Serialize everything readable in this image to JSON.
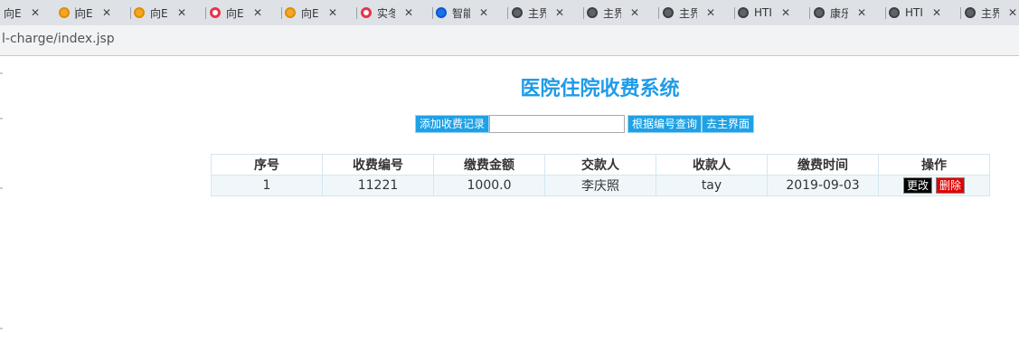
{
  "browser": {
    "tabs": [
      {
        "title": "向E",
        "favicon": "orange-circle-icon",
        "fav": "fav-orange"
      },
      {
        "title": "向E",
        "favicon": "orange-circle-icon",
        "fav": "fav-orange"
      },
      {
        "title": "向E",
        "favicon": "orange-circle-icon",
        "fav": "fav-orange"
      },
      {
        "title": "向E",
        "favicon": "red-ring-icon",
        "fav": "fav-red"
      },
      {
        "title": "向E",
        "favicon": "orange-circle-icon",
        "fav": "fav-orange"
      },
      {
        "title": "实冬",
        "favicon": "red-ring-icon",
        "fav": "fav-red"
      },
      {
        "title": "智能",
        "favicon": "blue-circle-icon",
        "fav": "fav-blue"
      },
      {
        "title": "主界",
        "favicon": "globe-icon",
        "fav": "fav-globe"
      },
      {
        "title": "主界",
        "favicon": "globe-icon",
        "fav": "fav-globe"
      },
      {
        "title": "主界",
        "favicon": "globe-icon",
        "fav": "fav-globe"
      },
      {
        "title": "HTI",
        "favicon": "globe-icon",
        "fav": "fav-globe"
      },
      {
        "title": "康乐",
        "favicon": "globe-icon",
        "fav": "fav-globe"
      },
      {
        "title": "HTI",
        "favicon": "globe-icon",
        "fav": "fav-globe"
      },
      {
        "title": "主界",
        "favicon": "globe-icon",
        "fav": "fav-globe"
      }
    ],
    "close_glyph": "✕",
    "url": "l-charge/index.jsp"
  },
  "page": {
    "title": "医院住院收费系统",
    "toolbar": {
      "add_label": "添加收费记录",
      "search_value": "",
      "search_label": "根据编号查询",
      "home_label": "去主界面"
    },
    "table": {
      "headers": [
        "序号",
        "收费编号",
        "缴费金额",
        "交款人",
        "收款人",
        "缴费时间",
        "操作"
      ],
      "rows": [
        {
          "seq": "1",
          "charge_no": "11221",
          "amount": "1000.0",
          "payer": "李庆照",
          "receiver": "tay",
          "date": "2019-09-03",
          "edit_label": "更改",
          "delete_label": "删除"
        }
      ]
    }
  },
  "colors": {
    "accent": "#1e9be8",
    "button": "#1ea1e6",
    "delete": "#e00000",
    "edit": "#000000"
  }
}
